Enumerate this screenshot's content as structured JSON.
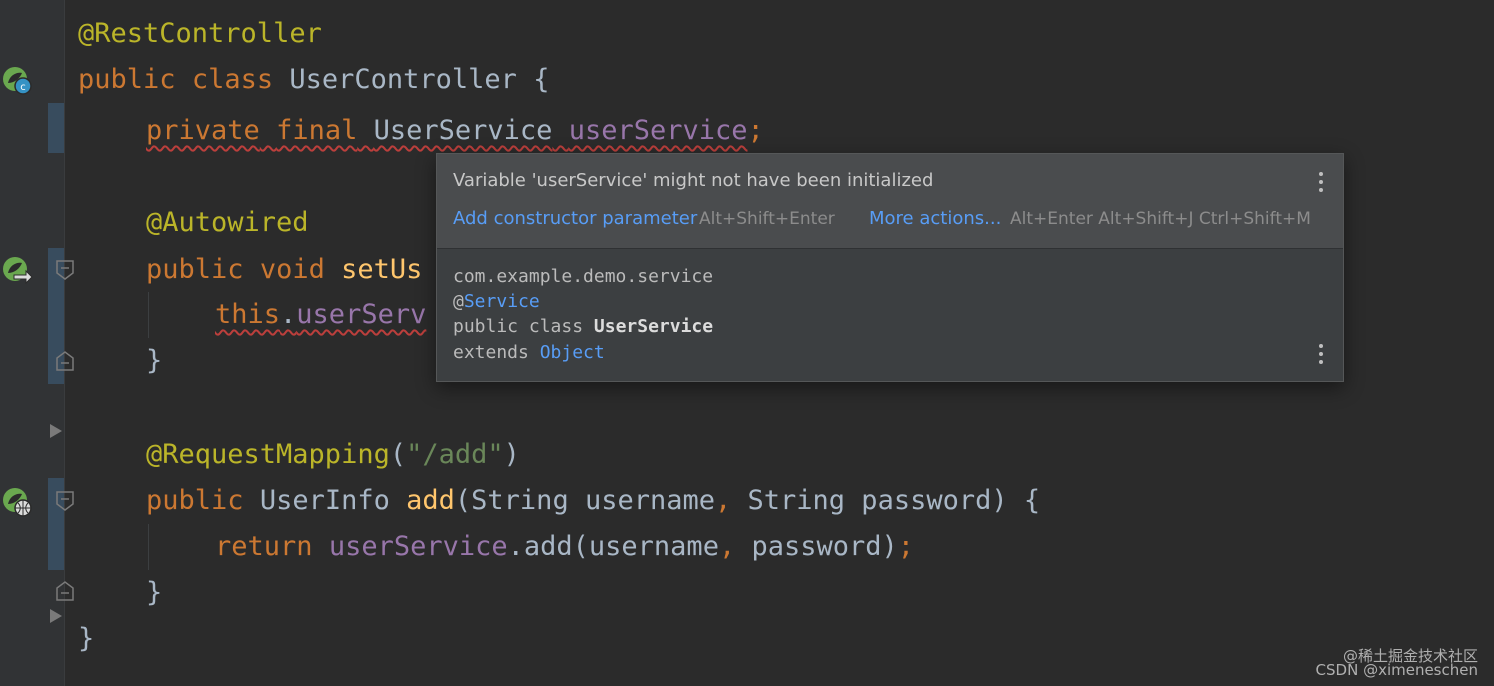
{
  "editor": {
    "lines": {
      "l1": {
        "annotation": "@RestController"
      },
      "l2": {
        "kw_public": "public",
        "kw_class": "class",
        "class_name": "UserController",
        "brace": " {"
      },
      "l3": {
        "kw_private": "private",
        "kw_final": "final",
        "type": "UserService",
        "field": "userService",
        "semicolon": ";"
      },
      "l4": {
        "annotation": "@Autowired"
      },
      "l5": {
        "kw_public": "public",
        "kw_void": "void",
        "method": "setUs"
      },
      "l6": {
        "kw_this": "this",
        "dot": ".",
        "field": "userServ"
      },
      "l7": {
        "brace": "}"
      },
      "l8": {
        "annotation": "@RequestMapping",
        "paren_open": "(",
        "string": "\"/add\"",
        "paren_close": ")"
      },
      "l9": {
        "kw_public": "public",
        "return_type": "UserInfo",
        "method": "add",
        "params_a": "(String username",
        "comma": ",",
        "params_b": " String password) {"
      },
      "l10": {
        "kw_return": "return",
        "field": "userService",
        "call": ".add(username",
        "comma": ",",
        "args_b": " password)",
        "semicolon": ";"
      },
      "l11": {
        "brace": "}"
      },
      "l12": {
        "brace": "}"
      }
    },
    "gutter_icons": [
      "spring-bean-class-icon",
      "spring-autowired-method-icon",
      "spring-request-mapping-icon"
    ]
  },
  "popup": {
    "message": "Variable 'userService' might not have been initialized",
    "action_primary": "Add constructor parameter",
    "action_primary_shortcut": "Alt+Shift+Enter",
    "action_more": "More actions...",
    "action_more_shortcut": "Alt+Enter Alt+Shift+J Ctrl+Shift+M",
    "doc": {
      "package": "com.example.demo.service",
      "at_sign": "@",
      "annotation": "Service",
      "decl_prefix": "public class ",
      "decl_name": "UserService",
      "extends_prefix": "extends ",
      "extends_name": "Object"
    }
  },
  "watermark": {
    "line1": "@稀土掘金技术社区",
    "line2": "CSDN @ximeneschen"
  },
  "colors": {
    "background": "#2b2b2b",
    "keyword": "#cc7832",
    "annotation": "#bbb529",
    "field": "#9876aa",
    "method": "#ffc66d",
    "string": "#6a8759",
    "plain": "#a9b7c6",
    "link": "#589df6",
    "error_underline": "#bc3f3c"
  }
}
